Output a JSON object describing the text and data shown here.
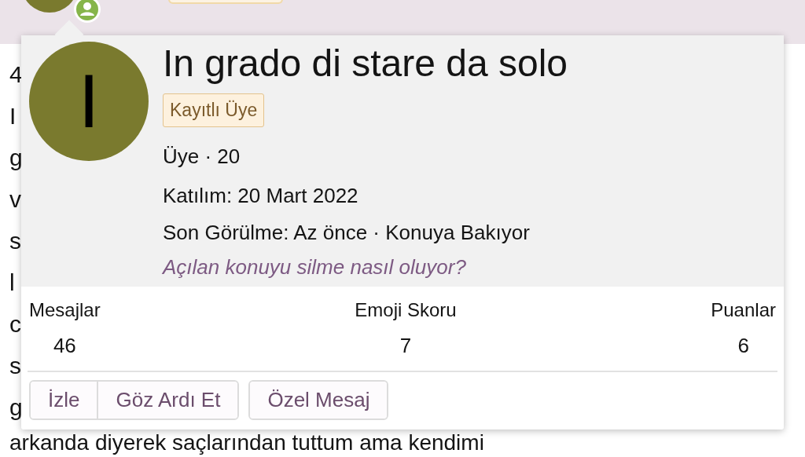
{
  "background_page": {
    "header_badge_visible": true,
    "lines": [
      "4",
      "I",
      "g",
      "v",
      "s",
      "l",
      "c",
      "s",
      "g",
      "arkanda diyerek saçlarından tuttum ama kendimi"
    ]
  },
  "member_card": {
    "avatar_letter": "I",
    "name": "In grado di stare da solo",
    "badge": "Kayıtlı Üye",
    "role_line": "Üye · 20",
    "joined": "Katılım: 20 Mart 2022",
    "last_seen": "Son Görülme: Az önce · Konuya Bakıyor ",
    "last_seen_link": "Açılan konuyu silme nasıl oluyor?",
    "stats": [
      {
        "label": "Mesajlar",
        "value": "46"
      },
      {
        "label": "Emoji Skoru",
        "value": "7"
      },
      {
        "label": "Puanlar",
        "value": "6"
      }
    ],
    "button_groups": [
      [
        "İzle",
        "Göz Ardı Et"
      ],
      [
        "Özel Mesaj"
      ]
    ]
  }
}
